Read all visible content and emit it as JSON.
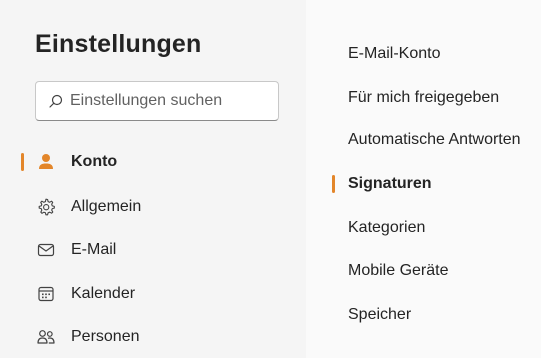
{
  "settings": {
    "title": "Einstellungen",
    "search": {
      "placeholder": "Einstellungen suchen",
      "value": ""
    },
    "nav": {
      "items": [
        {
          "label": "Konto",
          "icon": "person-icon",
          "active": true
        },
        {
          "label": "Allgemein",
          "icon": "gear-icon",
          "active": false
        },
        {
          "label": "E-Mail",
          "icon": "mail-icon",
          "active": false
        },
        {
          "label": "Kalender",
          "icon": "calendar-icon",
          "active": false
        },
        {
          "label": "Personen",
          "icon": "people-icon",
          "active": false
        }
      ]
    },
    "subnav": {
      "items": [
        {
          "label": "E-Mail-Konto",
          "active": false
        },
        {
          "label": "Für mich freigegeben",
          "active": false
        },
        {
          "label": "Automatische Antworten",
          "active": false
        },
        {
          "label": "Signaturen",
          "active": true
        },
        {
          "label": "Kategorien",
          "active": false
        },
        {
          "label": "Mobile Geräte",
          "active": false
        },
        {
          "label": "Speicher",
          "active": false
        }
      ]
    }
  },
  "colors": {
    "accent": "#e3862a",
    "pane_left": "#f5f5f5",
    "pane_right": "#fafafa",
    "text": "#242424"
  }
}
